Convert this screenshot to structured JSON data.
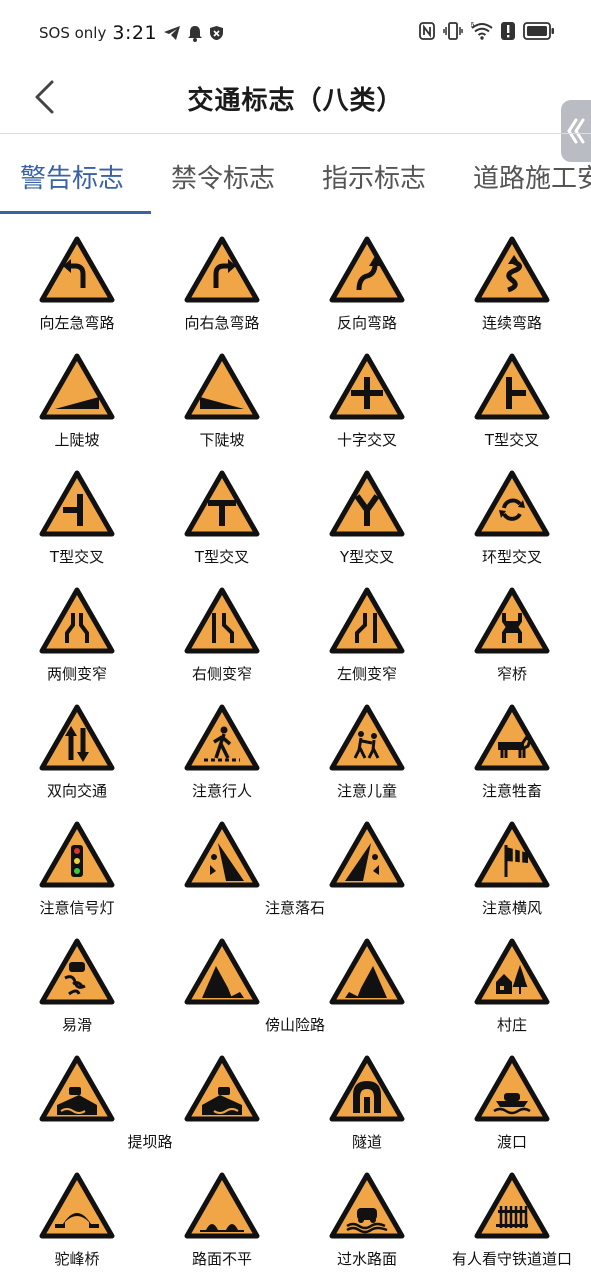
{
  "status_bar": {
    "carrier": "SOS only",
    "time": "3:21",
    "left_icons": [
      "telegram-icon",
      "bell-icon",
      "shield-icon"
    ],
    "right_icons": [
      "nfc-icon",
      "vibrate-icon",
      "wifi-icon",
      "alert-icon",
      "battery-icon"
    ],
    "wifi_badge": "6"
  },
  "header": {
    "title": "交通标志（八类）",
    "back_icon": "chevron-left-icon",
    "side_handle_icon": "double-chevron-left-icon"
  },
  "tabs": [
    {
      "label": "警告标志",
      "active": true
    },
    {
      "label": "禁令标志",
      "active": false
    },
    {
      "label": "指示标志",
      "active": false
    },
    {
      "label": "道路施工安",
      "active": false
    }
  ],
  "colors": {
    "accent": "#3a62a7",
    "sign_fill": "#f0a546",
    "sign_border": "#111111"
  },
  "signs": [
    {
      "label": "向左急弯路",
      "icon": "sharp-left-curve"
    },
    {
      "label": "向右急弯路",
      "icon": "sharp-right-curve"
    },
    {
      "label": "反向弯路",
      "icon": "reverse-curve"
    },
    {
      "label": "连续弯路",
      "icon": "winding-road"
    },
    {
      "label": "上陡坡",
      "icon": "steep-ascent"
    },
    {
      "label": "下陡坡",
      "icon": "steep-descent"
    },
    {
      "label": "十字交叉",
      "icon": "crossroads"
    },
    {
      "label": "T型交叉",
      "icon": "t-junction-right"
    },
    {
      "label": "T型交叉",
      "icon": "t-junction-left"
    },
    {
      "label": "T型交叉",
      "icon": "t-junction"
    },
    {
      "label": "Y型交叉",
      "icon": "y-junction"
    },
    {
      "label": "环型交叉",
      "icon": "roundabout"
    },
    {
      "label": "两侧变窄",
      "icon": "road-narrows-both"
    },
    {
      "label": "右侧变窄",
      "icon": "road-narrows-right"
    },
    {
      "label": "左侧变窄",
      "icon": "road-narrows-left"
    },
    {
      "label": "窄桥",
      "icon": "narrow-bridge"
    },
    {
      "label": "双向交通",
      "icon": "two-way-traffic"
    },
    {
      "label": "注意行人",
      "icon": "pedestrians"
    },
    {
      "label": "注意儿童",
      "icon": "children"
    },
    {
      "label": "注意牲畜",
      "icon": "livestock"
    },
    {
      "label": "注意信号灯",
      "icon": "traffic-signals"
    },
    {
      "label": "",
      "icon": "falling-rocks-left"
    },
    {
      "label": "",
      "icon": "falling-rocks-right"
    },
    {
      "label": "注意横风",
      "icon": "crosswind"
    },
    {
      "label": "易滑",
      "icon": "slippery-road"
    },
    {
      "label": "",
      "icon": "mountain-road-left"
    },
    {
      "label": "",
      "icon": "mountain-road-right"
    },
    {
      "label": "村庄",
      "icon": "village"
    },
    {
      "label": "",
      "icon": "embankment-left"
    },
    {
      "label": "",
      "icon": "embankment-right"
    },
    {
      "label": "隧道",
      "icon": "tunnel"
    },
    {
      "label": "渡口",
      "icon": "ferry"
    },
    {
      "label": "驼峰桥",
      "icon": "hump-bridge"
    },
    {
      "label": "路面不平",
      "icon": "uneven-road"
    },
    {
      "label": "过水路面",
      "icon": "ford"
    },
    {
      "label": "有人看守铁道道口",
      "icon": "guarded-railway-crossing"
    }
  ],
  "shared_labels": [
    {
      "label": "注意落石",
      "row": 5
    },
    {
      "label": "傍山险路",
      "row": 6
    },
    {
      "label": "提坝路",
      "row": 7
    }
  ]
}
